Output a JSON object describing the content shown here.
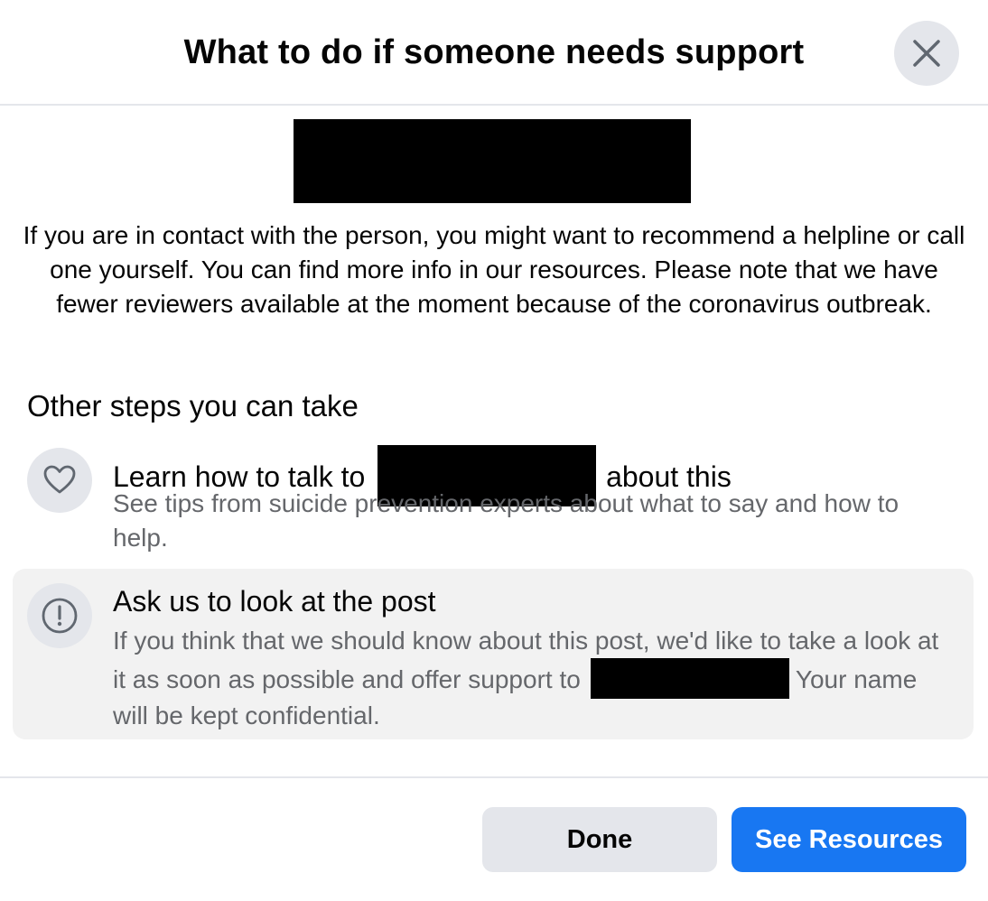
{
  "dialog": {
    "title": "What to do if someone needs support",
    "close_icon": "close-icon"
  },
  "intro": {
    "text": "If you are in contact with the person, you might want to recommend a helpline or call one yourself. You can find more info in our resources. Please note that we have fewer reviewers available at the moment because of the coronavirus outbreak."
  },
  "steps": {
    "heading": "Other steps you can take",
    "items": [
      {
        "icon": "heart-icon",
        "title_prefix": "Learn how to talk to",
        "title_suffix": "about this",
        "description": "See tips from suicide prevention experts about what to say and how to help."
      },
      {
        "icon": "exclamation-circle-icon",
        "title": "Ask us to look at the post",
        "description_part1": "If you think that we should know about this post, we'd like to take a look at it as soon as possible and offer support to",
        "description_part2": "Your name will be kept confidential."
      }
    ]
  },
  "footer": {
    "done_label": "Done",
    "resources_label": "See Resources"
  },
  "colors": {
    "primary_blue": "#1877f2",
    "secondary_gray": "#e4e6eb",
    "highlight_bg": "#f2f2f2",
    "muted_text": "#65676b"
  }
}
